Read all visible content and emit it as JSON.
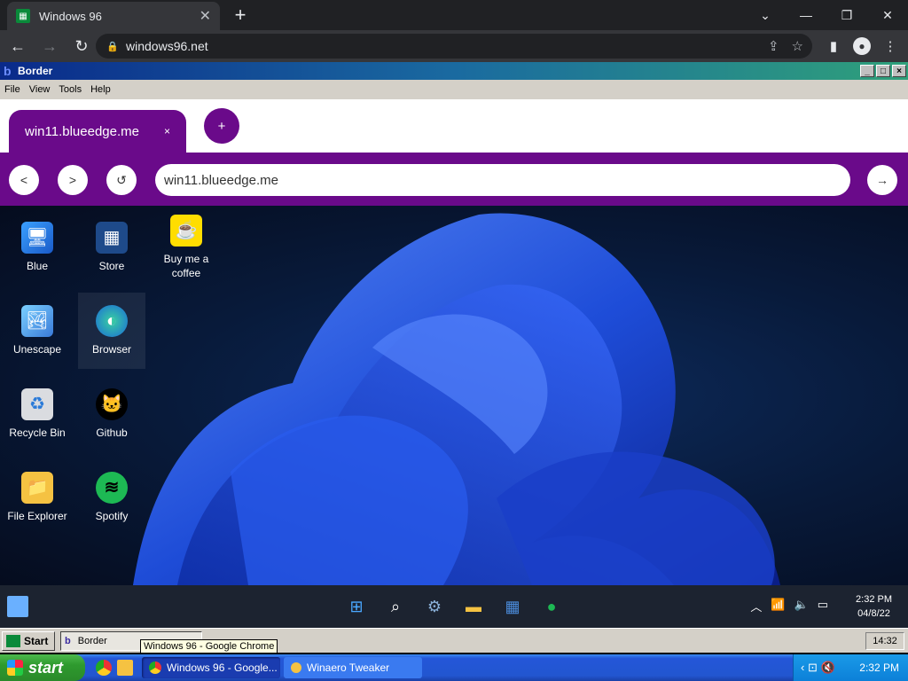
{
  "chrome": {
    "tab_title": "Windows 96",
    "tab_close": "✕",
    "new_tab": "+",
    "window_controls": [
      "⌄",
      "—",
      "❐",
      "✕"
    ],
    "url": "windows96.net"
  },
  "w96_window": {
    "title": "Border",
    "menu": [
      "File",
      "View",
      "Tools",
      "Help"
    ]
  },
  "blueedge": {
    "tab_title": "win11.blueedge.me",
    "tab_close": "×",
    "new_tab": "+",
    "url": "win11.blueedge.me",
    "back": "<",
    "forward": ">",
    "reload": "↺",
    "go": "→"
  },
  "desktop": {
    "icons": [
      {
        "label": "Blue"
      },
      {
        "label": "Store"
      },
      {
        "label": "Buy me a coffee"
      },
      {
        "label": "Unescape"
      },
      {
        "label": "Browser"
      },
      {
        "label": "Recycle Bin"
      },
      {
        "label": "Github"
      },
      {
        "label": "File Explorer"
      },
      {
        "label": "Spotify"
      }
    ]
  },
  "win11_taskbar": {
    "time": "2:32 PM",
    "date": "04/8/22"
  },
  "w96_taskbar": {
    "start": "Start",
    "task": "Border",
    "tooltip": "Windows 96 - Google Chrome",
    "clock": "14:32"
  },
  "xp_taskbar": {
    "start": "start",
    "tasks": [
      "Windows 96 - Google...",
      "Winaero Tweaker"
    ],
    "time": "2:32 PM"
  },
  "colors": {
    "accent": "#6a0a8a",
    "xp_blue": "#2456d8"
  }
}
